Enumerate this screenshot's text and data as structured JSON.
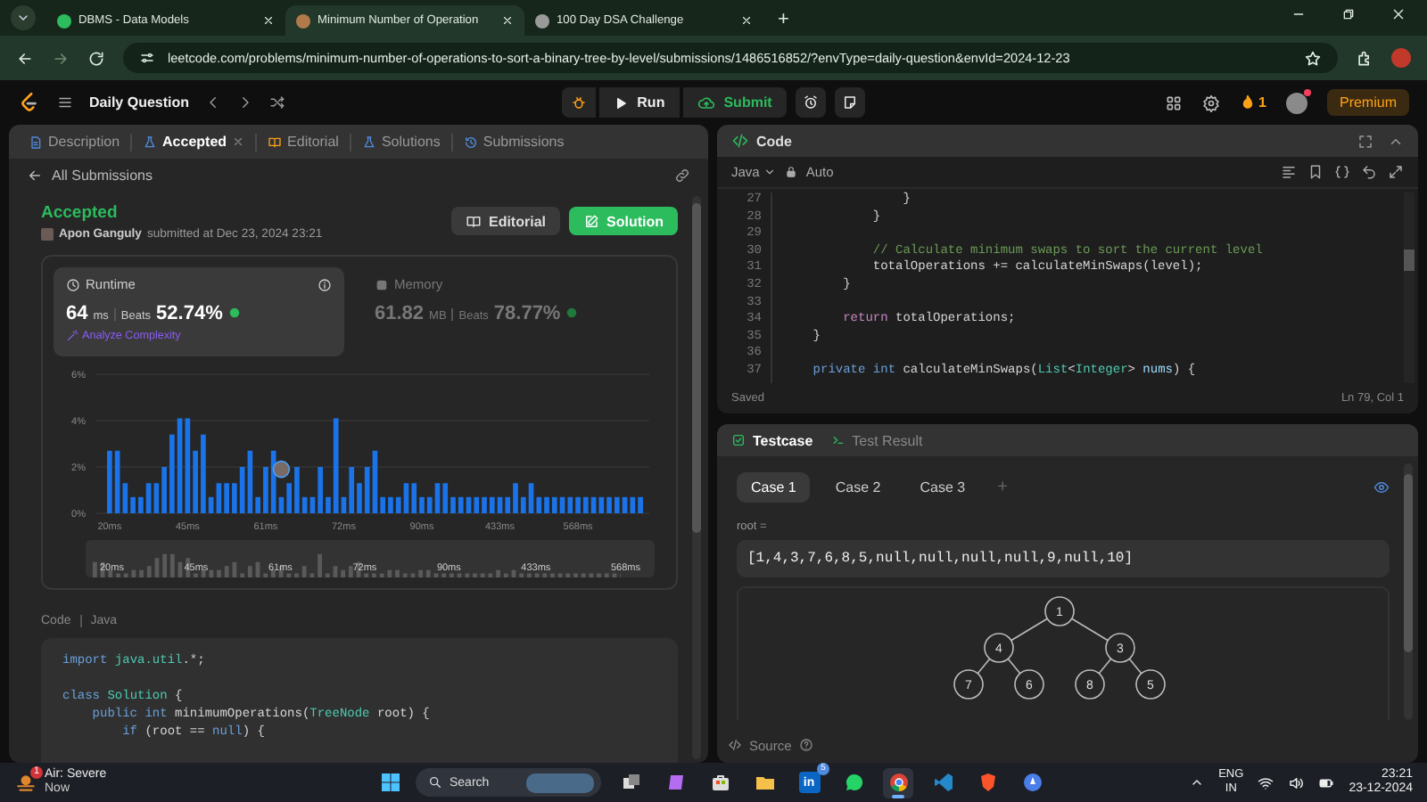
{
  "browser": {
    "tabs": [
      {
        "title": "DBMS - Data Models",
        "selected": false,
        "color": "#2cbb5d"
      },
      {
        "title": "Minimum Number of Operation",
        "selected": true,
        "color": "#b07a4a"
      },
      {
        "title": "100 Day DSA Challenge",
        "selected": false,
        "color": "#9a9a9a"
      }
    ],
    "new_tab": "+",
    "url": "leetcode.com/problems/minimum-number-of-operations-to-sort-a-binary-tree-by-level/submissions/1486516852/?envType=daily-question&envId=2024-12-23"
  },
  "header": {
    "title": "Daily Question",
    "run": "Run",
    "submit": "Submit",
    "streak": "1",
    "premium": "Premium"
  },
  "left_panel": {
    "tabs": [
      {
        "label": "Description",
        "selected": false,
        "closable": false,
        "kind": "description"
      },
      {
        "label": "Accepted",
        "selected": true,
        "closable": true,
        "kind": "accepted"
      },
      {
        "label": "Editorial",
        "selected": false,
        "closable": false,
        "kind": "editorial"
      },
      {
        "label": "Solutions",
        "selected": false,
        "closable": false,
        "kind": "solutions"
      },
      {
        "label": "Submissions",
        "selected": false,
        "closable": false,
        "kind": "submissions"
      }
    ],
    "back_link": "All Submissions",
    "status": "Accepted",
    "author": "Apon Ganguly",
    "submitted": "submitted at Dec 23, 2024 23:21",
    "buttons": [
      {
        "label": "Editorial",
        "kind": "editorial"
      },
      {
        "label": "Solution",
        "kind": "solution"
      }
    ],
    "stats": [
      {
        "title": "Runtime",
        "value": "64",
        "unit": "ms",
        "beats_label": "Beats",
        "beats": "52.74%",
        "selected": true,
        "link": "Analyze Complexity"
      },
      {
        "title": "Memory",
        "value": "61.82",
        "unit": "MB",
        "beats_label": "Beats",
        "beats": "78.77%",
        "selected": false
      }
    ],
    "chart_data": {
      "type": "bar",
      "ylim": [
        0,
        6
      ],
      "yticks": [
        {
          "value": 0,
          "label": "0%"
        },
        {
          "value": 2,
          "label": "2%"
        },
        {
          "value": 4,
          "label": "4%"
        },
        {
          "value": 6,
          "label": "6%"
        }
      ],
      "categories": [
        "20ms",
        null,
        null,
        null,
        null,
        null,
        null,
        null,
        null,
        null,
        "45ms",
        null,
        null,
        null,
        null,
        null,
        null,
        null,
        null,
        null,
        "61ms",
        null,
        null,
        null,
        null,
        null,
        null,
        null,
        null,
        null,
        "72ms",
        null,
        null,
        null,
        null,
        null,
        null,
        null,
        null,
        null,
        "90ms",
        null,
        null,
        null,
        null,
        null,
        null,
        null,
        null,
        null,
        "433ms",
        null,
        null,
        null,
        null,
        null,
        null,
        null,
        null,
        null,
        "568ms",
        null,
        null,
        null,
        null,
        null,
        null,
        null,
        null
      ],
      "values": [
        2.7,
        2.7,
        1.3,
        0.7,
        0.7,
        1.3,
        1.3,
        2.0,
        3.4,
        4.1,
        4.1,
        2.7,
        3.4,
        0.7,
        1.3,
        1.3,
        1.3,
        2.0,
        2.7,
        0.7,
        2.0,
        2.7,
        0.7,
        1.3,
        2.0,
        0.7,
        0.7,
        2.0,
        0.7,
        4.1,
        0.7,
        2.0,
        1.3,
        2.0,
        2.7,
        0.7,
        0.7,
        0.7,
        1.3,
        1.3,
        0.7,
        0.7,
        1.3,
        1.3,
        0.7,
        0.7,
        0.7,
        0.7,
        0.7,
        0.7,
        0.7,
        0.7,
        1.3,
        0.7,
        1.3,
        0.7,
        0.7,
        0.7,
        0.7,
        0.7,
        0.7,
        0.7,
        0.7,
        0.7,
        0.7,
        0.7,
        0.7,
        0.7,
        0.7
      ]
    },
    "range_labels": [
      "20ms",
      "45ms",
      "61ms",
      "72ms",
      "90ms",
      "433ms",
      "568ms"
    ],
    "code_label": "Code",
    "language": "Java",
    "code": [
      {
        "kind": "code",
        "tokens": [
          {
            "text": "import",
            "kind": "keyword"
          },
          {
            "text": " java.util",
            "kind": "type"
          },
          {
            "text": ".*;",
            "kind": "plain"
          }
        ]
      },
      {
        "kind": "blank"
      },
      {
        "kind": "code",
        "tokens": [
          {
            "text": "class",
            "kind": "keyword"
          },
          {
            "text": " Solution",
            "kind": "type"
          },
          {
            "text": " {",
            "kind": "plain"
          }
        ]
      },
      {
        "kind": "code",
        "tokens": [
          {
            "text": "    public",
            "kind": "keyword"
          },
          {
            "text": " int",
            "kind": "keyword"
          },
          {
            "text": " minimumOperations(",
            "kind": "plain"
          },
          {
            "text": "TreeNode",
            "kind": "type"
          },
          {
            "text": " root) {",
            "kind": "plain"
          }
        ]
      },
      {
        "kind": "code",
        "tokens": [
          {
            "text": "        if",
            "kind": "keyword"
          },
          {
            "text": " (root == ",
            "kind": "plain"
          },
          {
            "text": "null",
            "kind": "keyword"
          },
          {
            "text": ") {",
            "kind": "plain"
          }
        ]
      }
    ]
  },
  "code_panel": {
    "title": "Code",
    "language": "Java",
    "mode": "Auto",
    "status": "Saved",
    "cursor": "Ln 79, Col 1",
    "lines": [
      {
        "number": "27",
        "tokens": [
          {
            "text": "                }",
            "kind": "plain"
          }
        ]
      },
      {
        "number": "28",
        "tokens": [
          {
            "text": "            }",
            "kind": "plain"
          }
        ]
      },
      {
        "number": "29"
      },
      {
        "number": "30",
        "tokens": [
          {
            "text": "            // Calculate minimum swaps to sort the current level",
            "kind": "comment"
          }
        ]
      },
      {
        "number": "31",
        "tokens": [
          {
            "text": "            totalOperations += calculateMinSwaps(level);",
            "kind": "plain"
          }
        ]
      },
      {
        "number": "32",
        "tokens": [
          {
            "text": "        }",
            "kind": "plain"
          }
        ]
      },
      {
        "number": "33"
      },
      {
        "number": "34",
        "tokens": [
          {
            "text": "        return",
            "kind": "control"
          },
          {
            "text": " totalOperations;",
            "kind": "plain"
          }
        ]
      },
      {
        "number": "35",
        "tokens": [
          {
            "text": "    }",
            "kind": "plain"
          }
        ]
      },
      {
        "number": "36"
      },
      {
        "number": "37",
        "tokens": [
          {
            "text": "    private",
            "kind": "keyword"
          },
          {
            "text": " int",
            "kind": "keyword"
          },
          {
            "text": " calculateMinSwaps(",
            "kind": "plain"
          },
          {
            "text": "List",
            "kind": "type"
          },
          {
            "text": "<",
            "kind": "plain"
          },
          {
            "text": "Integer",
            "kind": "type"
          },
          {
            "text": ">",
            "kind": "plain"
          },
          {
            "text": " nums",
            "kind": "variable"
          },
          {
            "text": ") {",
            "kind": "plain"
          }
        ]
      }
    ]
  },
  "testcase": {
    "tabs": [
      {
        "label": "Testcase",
        "selected": true,
        "kind": "testcase"
      },
      {
        "label": "Test Result",
        "selected": false,
        "kind": "result"
      }
    ],
    "cases": [
      {
        "label": "Case 1",
        "selected": true
      },
      {
        "label": "Case 2",
        "selected": false
      },
      {
        "label": "Case 3",
        "selected": false
      }
    ],
    "add": "+",
    "param": "root =",
    "value": "[1,4,3,7,6,8,5,null,null,null,null,9,null,10]",
    "tree": {
      "label": "1",
      "left": {
        "label": "4",
        "left": {
          "label": "7"
        },
        "right": {
          "label": "6"
        }
      },
      "right": {
        "label": "3",
        "left": {
          "label": "8"
        },
        "right": {
          "label": "5"
        }
      }
    },
    "source": "Source"
  },
  "taskbar": {
    "weather": {
      "badge": "1",
      "title": "Air: Severe",
      "subtitle": "Now"
    },
    "search": "Search",
    "apps": [
      {
        "kind": "taskview",
        "active": false
      },
      {
        "kind": "copilot",
        "active": false
      },
      {
        "kind": "store",
        "active": false
      },
      {
        "kind": "files",
        "active": false
      },
      {
        "kind": "linkedin",
        "label": "in",
        "badge": "5",
        "active": false
      },
      {
        "kind": "whatsapp",
        "active": false
      },
      {
        "kind": "chrome",
        "active": true
      },
      {
        "kind": "vscode",
        "active": false
      },
      {
        "kind": "brave",
        "active": false
      },
      {
        "kind": "compass",
        "active": false
      }
    ],
    "lang": "ENG",
    "region": "IN",
    "time": "23:21",
    "date": "23-12-2024"
  }
}
